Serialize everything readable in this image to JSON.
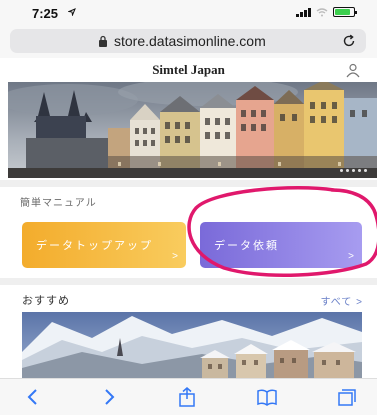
{
  "status_bar": {
    "time": "7:25",
    "location_icon": "location-arrow-icon",
    "signal_icon": "cellular-signal-icon",
    "wifi_icon": "wifi-icon",
    "battery_icon": "battery-icon",
    "battery_level": 0.85,
    "battery_color": "#3ccf4e"
  },
  "address_bar": {
    "url": "store.datasimonline.com",
    "lock_icon": "lock-icon",
    "reload_icon": "reload-icon"
  },
  "site": {
    "title": "Simtel Japan",
    "user_icon": "user-icon"
  },
  "hero": {
    "image": "prague-old-town-square-photo",
    "dot_count": 5
  },
  "manual": {
    "label": "簡単マニュアル"
  },
  "buttons": {
    "topup_label": "データトップアップ",
    "topup_color": "#f3ac2c",
    "request_label": "データ依頼",
    "request_color": "#7a6ad9",
    "chevron": ">"
  },
  "annotation": {
    "color": "#e0186c"
  },
  "recommend": {
    "label": "おすすめ",
    "see_all": "すべて >"
  },
  "photo2": {
    "image": "hallstatt-winter-photo"
  },
  "toolbar": {
    "back_icon": "back-chevron-icon",
    "forward_icon": "forward-chevron-icon",
    "share_icon": "share-icon",
    "bookmarks_icon": "bookmarks-icon",
    "tabs_icon": "tabs-icon",
    "tint": "#3478f6"
  }
}
